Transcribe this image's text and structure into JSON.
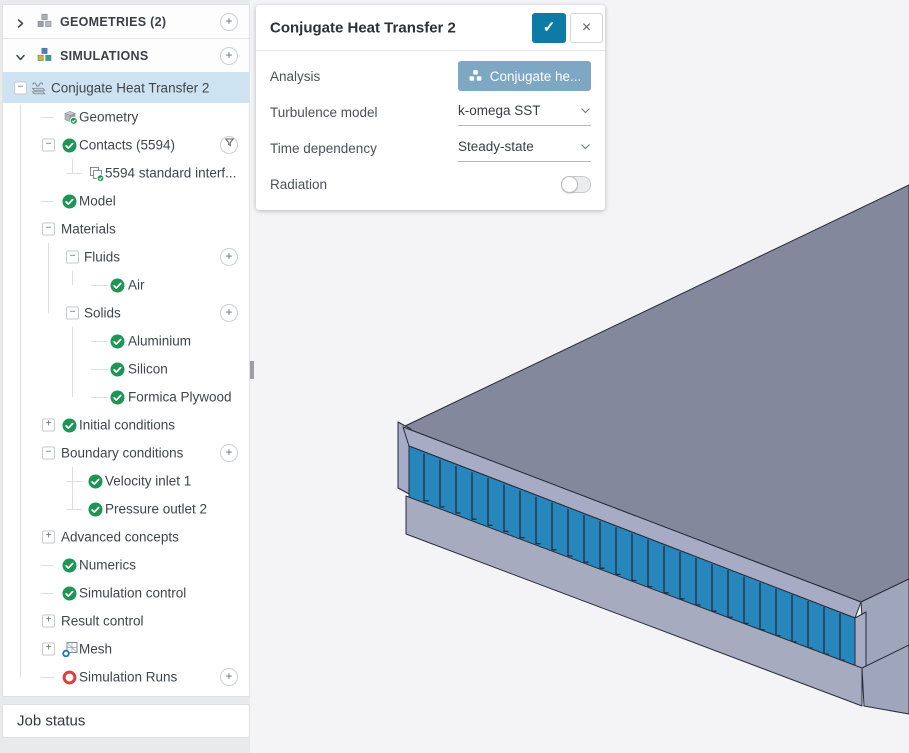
{
  "icons": {
    "plus": "+",
    "minus": "−",
    "close": "×",
    "confirm": "✓"
  },
  "tree": {
    "sections": [
      {
        "label": "GEOMETRIES (2)",
        "chevron": "right",
        "icon": "geometries",
        "trailing": "plus"
      },
      {
        "label": "SIMULATIONS",
        "chevron": "down",
        "icon": "simulations",
        "trailing": "plus"
      }
    ],
    "items": [
      {
        "label": "Conjugate Heat Transfer 2",
        "level": 1,
        "expander": "minus",
        "icon": "simulation-setup",
        "selected": true
      },
      {
        "label": "Geometry",
        "level": 2,
        "icon": "geometry-cube-check"
      },
      {
        "label": "Contacts (5594)",
        "level": 2,
        "expander": "minus",
        "icon": "check",
        "trailing": "filter"
      },
      {
        "label": "5594 standard interf...",
        "level": 3,
        "icon": "copy-check"
      },
      {
        "label": "Model",
        "level": 2,
        "icon": "check"
      },
      {
        "label": "Materials",
        "level": 2,
        "expander": "minus"
      },
      {
        "label": "Fluids",
        "level": 3,
        "expander": "minus",
        "trailing": "plus"
      },
      {
        "label": "Air",
        "level": 4,
        "icon": "check"
      },
      {
        "label": "Solids",
        "level": 3,
        "expander": "minus",
        "trailing": "plus"
      },
      {
        "label": "Aluminium",
        "level": 4,
        "icon": "check"
      },
      {
        "label": "Silicon",
        "level": 4,
        "icon": "check"
      },
      {
        "label": "Formica Plywood",
        "level": 4,
        "icon": "check"
      },
      {
        "label": "Initial conditions",
        "level": 2,
        "expander": "plus",
        "icon": "check"
      },
      {
        "label": "Boundary conditions",
        "level": 2,
        "expander": "minus",
        "trailing": "plus"
      },
      {
        "label": "Velocity inlet 1",
        "level": 3,
        "icon": "check"
      },
      {
        "label": "Pressure outlet 2",
        "level": 3,
        "icon": "check"
      },
      {
        "label": "Advanced concepts",
        "level": 2,
        "expander": "plus"
      },
      {
        "label": "Numerics",
        "level": 2,
        "icon": "check"
      },
      {
        "label": "Simulation control",
        "level": 2,
        "icon": "check"
      },
      {
        "label": "Result control",
        "level": 2,
        "expander": "plus"
      },
      {
        "label": "Mesh",
        "level": 2,
        "expander": "plus",
        "icon": "mesh"
      },
      {
        "label": "Simulation Runs",
        "level": 2,
        "icon": "run-failed",
        "trailing": "plus"
      }
    ]
  },
  "panel": {
    "title": "Conjugate Heat Transfer 2",
    "fields": [
      {
        "label": "Analysis",
        "type": "button",
        "value": "Conjugate he...",
        "icon": "analysis-cubes"
      },
      {
        "label": "Turbulence model",
        "type": "select",
        "value": "k-omega SST"
      },
      {
        "label": "Time dependency",
        "type": "select",
        "value": "Steady-state"
      },
      {
        "label": "Radiation",
        "type": "toggle",
        "value": "off"
      }
    ]
  },
  "job_status": {
    "label": "Job status"
  },
  "colors": {
    "accent": "#0e7aa6",
    "selected_row": "#cee3f1",
    "success_green": "#1e9554",
    "error_red": "#e23b41",
    "mesh_blue": "#1778c9",
    "analysis_button": "#7ea7c3"
  },
  "scene": {
    "fin_count": 27,
    "colors": {
      "background": "#f4f4f6",
      "top_face": "#83889c",
      "rim": "#a7acc4",
      "fin_face": "#2787bd",
      "base": "#a6abc0",
      "side": "#9fa5bb",
      "edge": "#262c3a"
    }
  }
}
